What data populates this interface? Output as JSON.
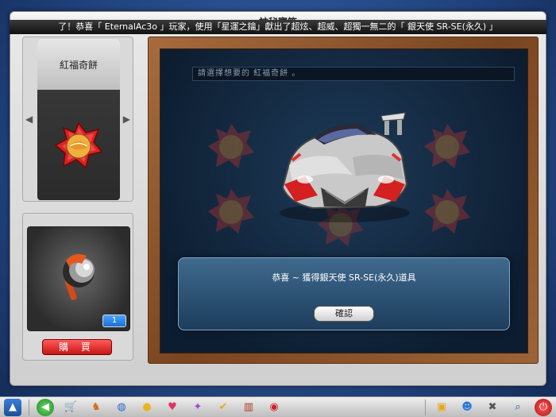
{
  "window": {
    "title": "神秘寶箱"
  },
  "ticker": {
    "text": "了！恭喜「 EternalAc3o 」玩家，使用「星運之鑰」獻出了超炫、超威、超獨一無二的「 銀天使 SR-SE(永久) 」"
  },
  "item_selector": {
    "name": "紅福奇餅",
    "prev_icon": "triangle-left",
    "next_icon": "triangle-right"
  },
  "item_preview": {
    "quantity": "1",
    "buy_label": "購  買"
  },
  "stage": {
    "search_placeholder": "請選擇想要的 紅福奇餅  。",
    "message": "恭喜 ~ 獲得銀天使 SR-SE(永久)道具",
    "confirm_label": "確認"
  },
  "taskbar": {
    "icons": [
      "kart-icon",
      "back-icon",
      "shop-cart-icon",
      "character-icon",
      "globe-icon",
      "duck-icon",
      "heart-icon",
      "magic-icon",
      "check-icon",
      "book-icon",
      "ball-icon",
      "gift-icon",
      "people-icon",
      "tools-icon",
      "search-icon",
      "power-icon"
    ]
  },
  "colors": {
    "accent_red": "#c71515",
    "stage_bg": "#0d1d30",
    "frame_wood": "#7a4520",
    "qty_blue": "#1d6fd4"
  }
}
